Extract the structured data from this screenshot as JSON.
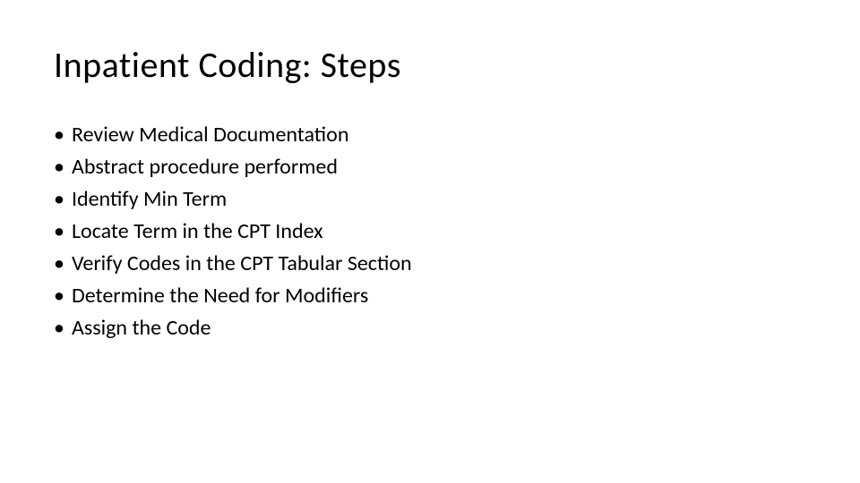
{
  "title": "Inpatient Coding:  Steps",
  "bullets": [
    "Review Medical Documentation",
    "Abstract procedure performed",
    "Identify Min Term",
    "Locate Term in the CPT Index",
    "Verify Codes in the CPT Tabular Section",
    "Determine the Need for Modifiers",
    "Assign the Code"
  ]
}
